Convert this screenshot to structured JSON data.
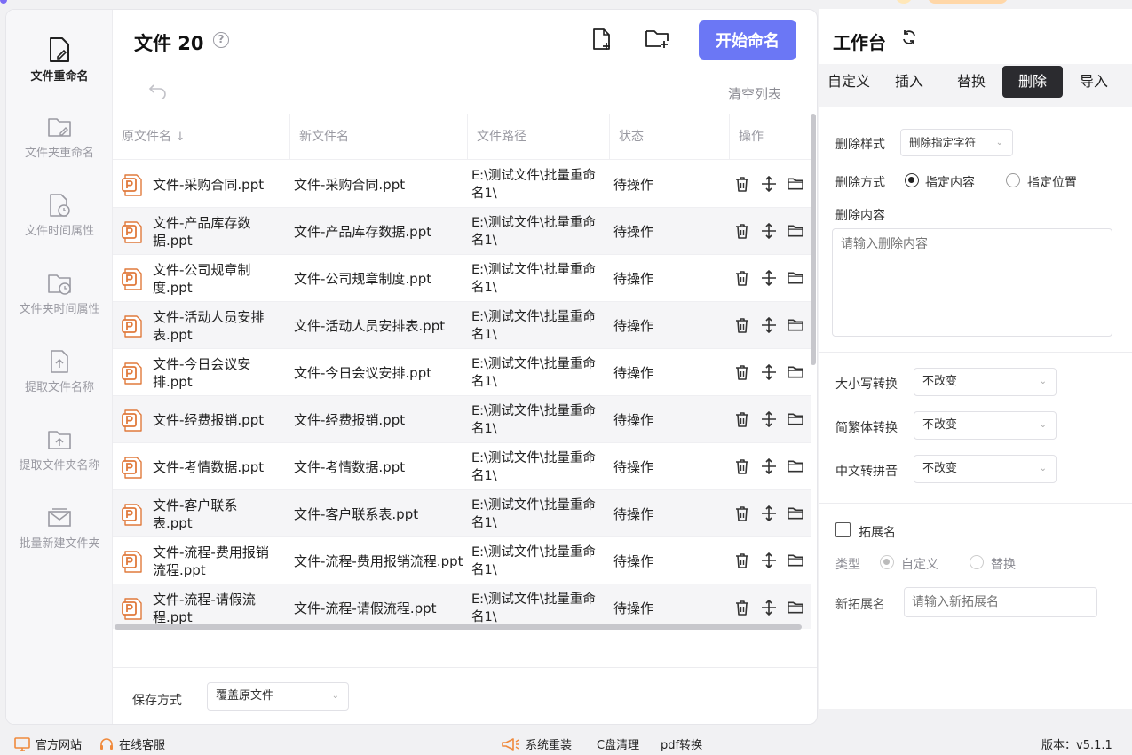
{
  "sidebar": {
    "items": [
      {
        "label": "文件重命名",
        "icon": "file-edit-icon",
        "active": true
      },
      {
        "label": "文件夹重命名",
        "icon": "folder-edit-icon"
      },
      {
        "label": "文件时间属性",
        "icon": "file-clock-icon"
      },
      {
        "label": "文件夹时间属性",
        "icon": "folder-clock-icon"
      },
      {
        "label": "提取文件名称",
        "icon": "file-export-icon"
      },
      {
        "label": "提取文件夹名称",
        "icon": "folder-export-icon"
      },
      {
        "label": "批量新建文件夹",
        "icon": "folder-mail-icon"
      }
    ]
  },
  "header": {
    "title": "文件 20",
    "help": "?",
    "start_button": "开始命名",
    "clear_list": "清空列表",
    "accent": "#6b77f5"
  },
  "table": {
    "columns": [
      "原文件名",
      "新文件名",
      "文件路径",
      "状态",
      "操作"
    ],
    "rows": [
      {
        "orig": "文件-采购合同.ppt",
        "new": "文件-采购合同.ppt",
        "path": "E:\\测试文件\\批量重命名1\\",
        "status": "待操作"
      },
      {
        "orig": "文件-产品库存数据.ppt",
        "new": "文件-产品库存数据.ppt",
        "path": "E:\\测试文件\\批量重命名1\\",
        "status": "待操作"
      },
      {
        "orig": "文件-公司规章制度.ppt",
        "new": "文件-公司规章制度.ppt",
        "path": "E:\\测试文件\\批量重命名1\\",
        "status": "待操作"
      },
      {
        "orig": "文件-活动人员安排表.ppt",
        "new": "文件-活动人员安排表.ppt",
        "path": "E:\\测试文件\\批量重命名1\\",
        "status": "待操作"
      },
      {
        "orig": "文件-今日会议安排.ppt",
        "new": "文件-今日会议安排.ppt",
        "path": "E:\\测试文件\\批量重命名1\\",
        "status": "待操作"
      },
      {
        "orig": "文件-经费报销.ppt",
        "new": "文件-经费报销.ppt",
        "path": "E:\\测试文件\\批量重命名1\\",
        "status": "待操作"
      },
      {
        "orig": "文件-考情数据.ppt",
        "new": "文件-考情数据.ppt",
        "path": "E:\\测试文件\\批量重命名1\\",
        "status": "待操作"
      },
      {
        "orig": "文件-客户联系表.ppt",
        "new": "文件-客户联系表.ppt",
        "path": "E:\\测试文件\\批量重命名1\\",
        "status": "待操作"
      },
      {
        "orig": "文件-流程-费用报销流程.ppt",
        "new": "文件-流程-费用报销流程.ppt",
        "path": "E:\\测试文件\\批量重命名1\\",
        "status": "待操作"
      },
      {
        "orig": "文件-流程-请假流程.ppt",
        "new": "文件-流程-请假流程.ppt",
        "path": "E:\\测试文件\\批量重命名1\\",
        "status": "待操作"
      }
    ]
  },
  "bottom": {
    "save_label": "保存方式",
    "save_value": "覆盖原文件"
  },
  "workspace": {
    "title": "工作台",
    "tabs": [
      "自定义",
      "插入",
      "替换",
      "删除",
      "导入"
    ],
    "active_tab": "删除",
    "delete_style_label": "删除样式",
    "delete_style_value": "删除指定字符",
    "delete_mode_label": "删除方式",
    "mode_content": "指定内容",
    "mode_position": "指定位置",
    "delete_content_label": "删除内容",
    "delete_content_placeholder": "请输入删除内容",
    "case_label": "大小写转换",
    "case_value": "不改变",
    "trad_label": "简繁体转换",
    "trad_value": "不改变",
    "pinyin_label": "中文转拼音",
    "pinyin_value": "不改变",
    "ext_label": "拓展名",
    "type_label": "类型",
    "type_custom": "自定义",
    "type_replace": "替换",
    "new_ext_label": "新拓展名",
    "new_ext_placeholder": "请输入新拓展名"
  },
  "footer": {
    "website": "官方网站",
    "service": "在线客服",
    "reinstall": "系统重装",
    "cclean": "C盘清理",
    "pdf": "pdf转换",
    "version": "版本：v5.1.1"
  }
}
